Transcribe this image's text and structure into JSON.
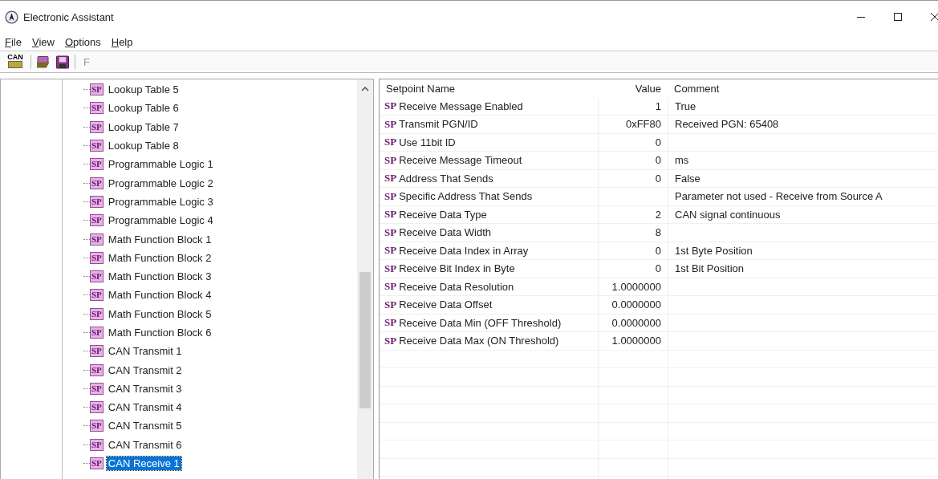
{
  "window": {
    "title": "Electronic Assistant"
  },
  "menu": [
    {
      "label": "File"
    },
    {
      "label": "View"
    },
    {
      "label": "Options"
    },
    {
      "label": "Help"
    }
  ],
  "toolbar": [
    {
      "kind": "can",
      "label": "CAN"
    },
    {
      "kind": "open"
    },
    {
      "kind": "save"
    },
    {
      "kind": "text",
      "label": "F"
    }
  ],
  "tree": {
    "items": [
      {
        "badge": "SP",
        "label": "Lookup Table 5",
        "selected": false
      },
      {
        "badge": "SP",
        "label": "Lookup Table 6",
        "selected": false
      },
      {
        "badge": "SP",
        "label": "Lookup Table 7",
        "selected": false
      },
      {
        "badge": "SP",
        "label": "Lookup Table 8",
        "selected": false
      },
      {
        "badge": "SP",
        "label": "Programmable Logic 1",
        "selected": false
      },
      {
        "badge": "SP",
        "label": "Programmable Logic 2",
        "selected": false
      },
      {
        "badge": "SP",
        "label": "Programmable Logic 3",
        "selected": false
      },
      {
        "badge": "SP",
        "label": "Programmable Logic 4",
        "selected": false
      },
      {
        "badge": "SP",
        "label": "Math Function Block 1",
        "selected": false
      },
      {
        "badge": "SP",
        "label": "Math Function Block 2",
        "selected": false
      },
      {
        "badge": "SP",
        "label": "Math Function Block 3",
        "selected": false
      },
      {
        "badge": "SP",
        "label": "Math Function Block 4",
        "selected": false
      },
      {
        "badge": "SP",
        "label": "Math Function Block 5",
        "selected": false
      },
      {
        "badge": "SP",
        "label": "Math Function Block 6",
        "selected": false
      },
      {
        "badge": "SP",
        "label": "CAN Transmit 1",
        "selected": false
      },
      {
        "badge": "SP",
        "label": "CAN Transmit 2",
        "selected": false
      },
      {
        "badge": "SP",
        "label": "CAN Transmit 3",
        "selected": false
      },
      {
        "badge": "SP",
        "label": "CAN Transmit 4",
        "selected": false
      },
      {
        "badge": "SP",
        "label": "CAN Transmit 5",
        "selected": false
      },
      {
        "badge": "SP",
        "label": "CAN Transmit 6",
        "selected": false
      },
      {
        "badge": "SP",
        "label": "CAN Receive 1",
        "selected": true
      }
    ]
  },
  "table": {
    "columns": [
      "Setpoint Name",
      "Value",
      "Comment"
    ],
    "rows": [
      {
        "badge": "SP",
        "name": "Receive Message Enabled",
        "value": "1",
        "comment": "True"
      },
      {
        "badge": "SP",
        "name": "Transmit PGN/ID",
        "value": "0xFF80",
        "comment": "Received PGN: 65408"
      },
      {
        "badge": "SP",
        "name": "Use 11bit ID",
        "value": "0"
      },
      {
        "badge": "SP",
        "name": "Receive Message Timeout",
        "value": "0",
        "comment": "ms"
      },
      {
        "badge": "SP",
        "name": "Address That Sends",
        "value": "0",
        "comment": "False"
      },
      {
        "badge": "SP",
        "name": "Specific Address That Sends",
        "comment": "Parameter not used - Receive from Source A"
      },
      {
        "badge": "SP",
        "name": "Receive Data Type",
        "value": "2",
        "comment": "CAN signal continuous"
      },
      {
        "badge": "SP",
        "name": "Receive Data Width",
        "value": "8"
      },
      {
        "badge": "SP",
        "name": "Receive Data Index in Array",
        "value": "0",
        "comment": "1st Byte Position"
      },
      {
        "badge": "SP",
        "name": "Receive Bit Index in Byte",
        "value": "0",
        "comment": "1st Bit Position"
      },
      {
        "badge": "SP",
        "name": "Receive Data Resolution",
        "value": "1.0000000"
      },
      {
        "badge": "SP",
        "name": "Receive Data Offset",
        "value": "0.0000000"
      },
      {
        "badge": "SP",
        "name": "Receive Data Min (OFF Threshold)",
        "value": "0.0000000"
      },
      {
        "badge": "SP",
        "name": "Receive Data Max (ON Threshold)",
        "value": "1.0000000"
      }
    ]
  }
}
